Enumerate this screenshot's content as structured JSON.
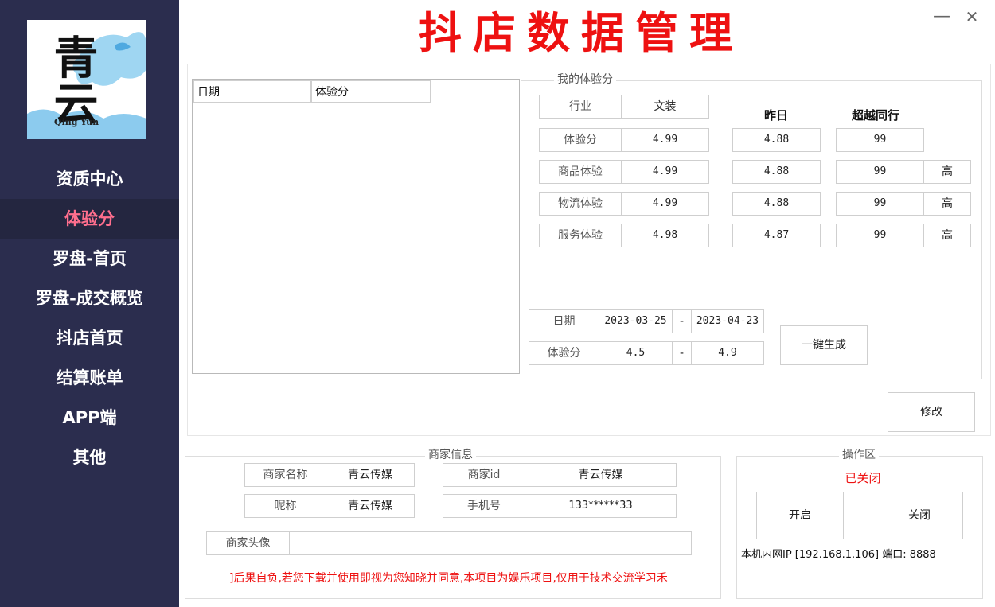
{
  "app": {
    "title": "抖店数据管理",
    "logo_text": "青云",
    "logo_subtext": "Qing Yun"
  },
  "window_controls": {
    "minimize": "—",
    "close": "✕"
  },
  "sidebar": {
    "items": [
      {
        "label": "资质中心"
      },
      {
        "label": "体验分"
      },
      {
        "label": "罗盘-首页"
      },
      {
        "label": "罗盘-成交概览"
      },
      {
        "label": "抖店首页"
      },
      {
        "label": "结算账单"
      },
      {
        "label": "APP端"
      },
      {
        "label": "其他"
      }
    ],
    "active_index": 1,
    "active_color": "#ff6f8e"
  },
  "history_table": {
    "columns": [
      "日期",
      "体验分"
    ],
    "rows": []
  },
  "score_group": {
    "title": "我的体验分",
    "industry_label": "行业",
    "industry_value": "文装",
    "col_yesterday": "昨日",
    "col_beyond": "超越同行",
    "rows": [
      {
        "label": "体验分",
        "value": "4.99",
        "yesterday": "4.88",
        "beyond": "99",
        "level": ""
      },
      {
        "label": "商品体验",
        "value": "4.99",
        "yesterday": "4.88",
        "beyond": "99",
        "level": "高"
      },
      {
        "label": "物流体验",
        "value": "4.99",
        "yesterday": "4.88",
        "beyond": "99",
        "level": "高"
      },
      {
        "label": "服务体验",
        "value": "4.98",
        "yesterday": "4.87",
        "beyond": "99",
        "level": "高"
      }
    ],
    "date_label": "日期",
    "date_from": "2023-03-25",
    "date_to": "2023-04-23",
    "range_sep": "-",
    "score_label": "体验分",
    "score_from": "4.5",
    "score_to": "4.9",
    "generate_button": "一键生成"
  },
  "modify_button": "修改",
  "merchant": {
    "title": "商家信息",
    "name_label": "商家名称",
    "name_value": "青云传媒",
    "id_label": "商家id",
    "id_value": "青云传媒",
    "nick_label": "昵称",
    "nick_value": "青云传媒",
    "phone_label": "手机号",
    "phone_value": "133******33",
    "avatar_label": "商家头像",
    "avatar_value": "",
    "disclaimer": "]后果自负,若您下载并使用即视为您知晓并同意,本项目为娱乐项目,仅用于技术交流学习禾"
  },
  "ops": {
    "title": "操作区",
    "status": "已关闭",
    "status_color": "#ee1111",
    "open_button": "开启",
    "close_button": "关闭",
    "ip_text": "本机内网IP [192.168.1.106]  端口: 8888"
  }
}
